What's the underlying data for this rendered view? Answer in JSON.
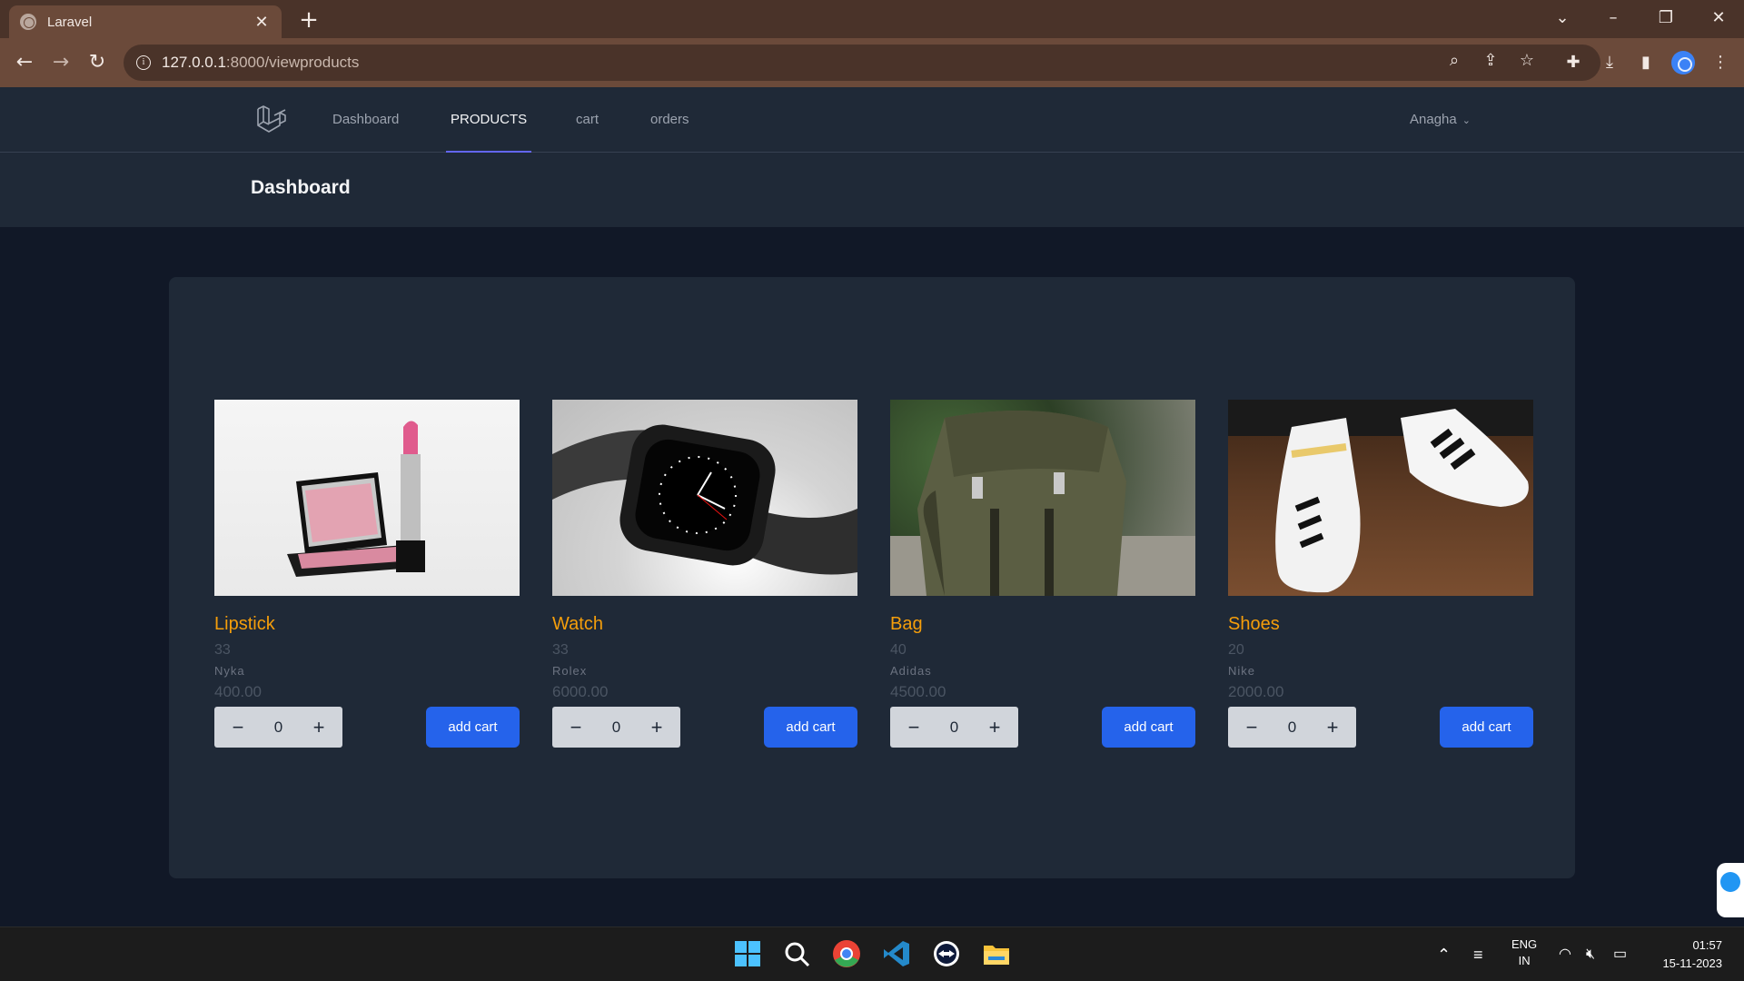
{
  "browser": {
    "tab_title": "Laravel",
    "url_host": "127.0.0.1",
    "url_rest": ":8000/viewproducts"
  },
  "nav": {
    "links": [
      "Dashboard",
      "PRODUCTS",
      "cart",
      "orders"
    ],
    "user_name": "Anagha"
  },
  "header": {
    "title": "Dashboard"
  },
  "products": [
    {
      "name": "Lipstick",
      "qty": "33",
      "brand": "Nyka",
      "price": "400.00",
      "count": "0",
      "button": "add cart"
    },
    {
      "name": "Watch",
      "qty": "33",
      "brand": "Rolex",
      "price": "6000.00",
      "count": "0",
      "button": "add cart"
    },
    {
      "name": "Bag",
      "qty": "40",
      "brand": "Adidas",
      "price": "4500.00",
      "count": "0",
      "button": "add cart"
    },
    {
      "name": "Shoes",
      "qty": "20",
      "brand": "Nike",
      "price": "2000.00",
      "count": "0",
      "button": "add cart"
    }
  ],
  "taskbar": {
    "lang_top": "ENG",
    "lang_bottom": "IN",
    "time": "01:57",
    "date": "15-11-2023"
  },
  "colors": {
    "accent": "#2563eb",
    "product_name": "#f59e0b",
    "active_tab_underline": "#6366f1",
    "browser_frame": "#6b4a3a"
  }
}
